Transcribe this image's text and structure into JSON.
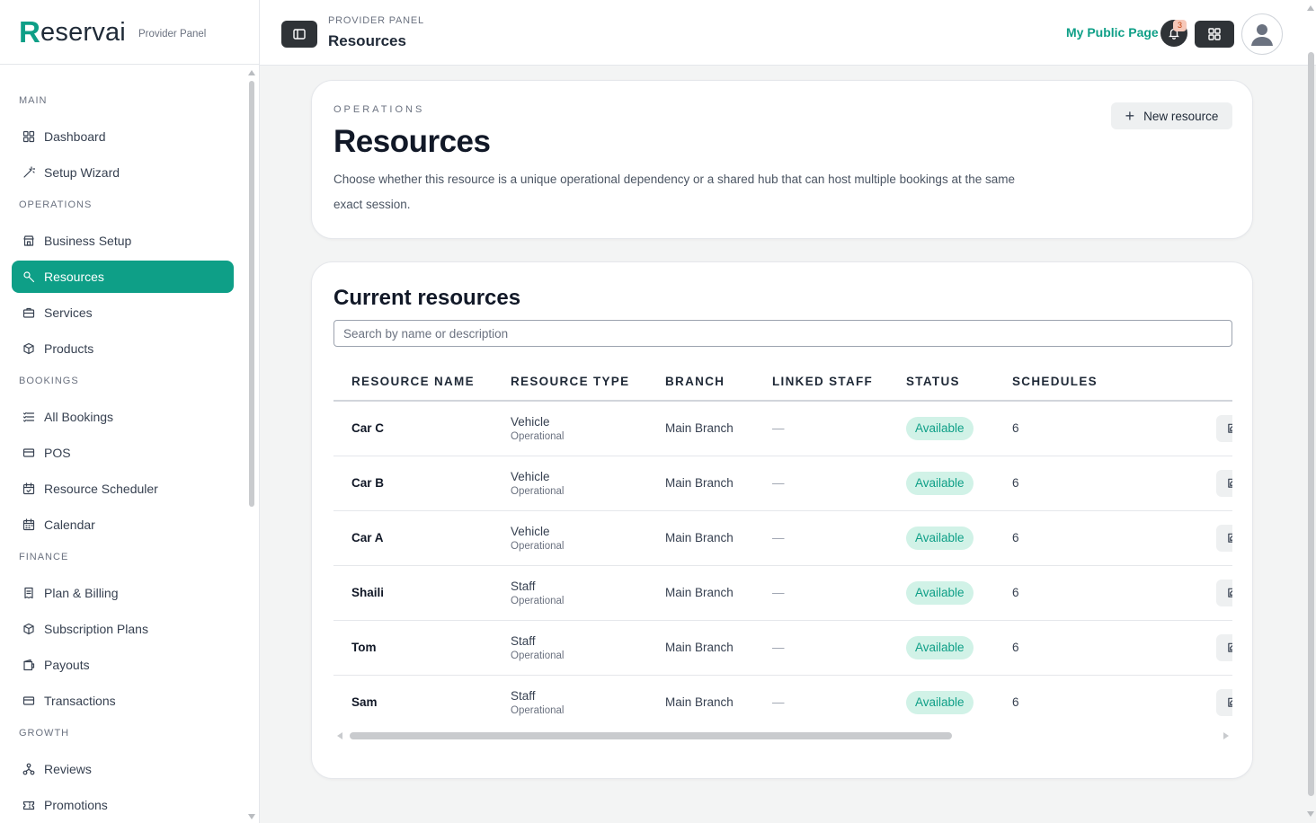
{
  "brand": {
    "logo_initial": "R",
    "logo_rest": "eservai",
    "subtitle": "Provider Panel"
  },
  "sidebar": {
    "sections": [
      {
        "title": "MAIN",
        "items": [
          {
            "label": "Dashboard",
            "icon": "grid-icon"
          },
          {
            "label": "Setup Wizard",
            "icon": "wand-icon"
          }
        ]
      },
      {
        "title": "OPERATIONS",
        "items": [
          {
            "label": "Business Setup",
            "icon": "store-icon"
          },
          {
            "label": "Resources",
            "icon": "wrench-icon",
            "active": true
          },
          {
            "label": "Services",
            "icon": "briefcase-icon"
          },
          {
            "label": "Products",
            "icon": "box-icon"
          }
        ]
      },
      {
        "title": "BOOKINGS",
        "items": [
          {
            "label": "All Bookings",
            "icon": "list-icon"
          },
          {
            "label": "POS",
            "icon": "card-icon"
          },
          {
            "label": "Resource Scheduler",
            "icon": "calendar-check-icon"
          },
          {
            "label": "Calendar",
            "icon": "calendar-icon"
          }
        ]
      },
      {
        "title": "FINANCE",
        "items": [
          {
            "label": "Plan & Billing",
            "icon": "receipt-icon"
          },
          {
            "label": "Subscription Plans",
            "icon": "box-icon"
          },
          {
            "label": "Payouts",
            "icon": "wallet-icon"
          },
          {
            "label": "Transactions",
            "icon": "card-icon"
          }
        ]
      },
      {
        "title": "GROWTH",
        "items": [
          {
            "label": "Reviews",
            "icon": "network-icon"
          },
          {
            "label": "Promotions",
            "icon": "ticket-icon"
          }
        ]
      }
    ]
  },
  "topbar": {
    "crumb_small": "PROVIDER PANEL",
    "crumb_title": "Resources",
    "public_link": "My Public Page",
    "notification_count": "3"
  },
  "hero": {
    "eyebrow": "OPERATIONS",
    "title": "Resources",
    "description": "Choose whether this resource is a unique operational dependency or a shared hub that can host multiple bookings at the same exact session.",
    "new_button": "New resource"
  },
  "resources": {
    "title": "Current resources",
    "search_placeholder": "Search by name or description",
    "columns": [
      "RESOURCE NAME",
      "RESOURCE TYPE",
      "BRANCH",
      "LINKED STAFF",
      "STATUS",
      "SCHEDULES",
      ""
    ],
    "edit_label": "Edit resource",
    "rows": [
      {
        "name": "Car C",
        "type": "Vehicle",
        "subtype": "Operational",
        "branch": "Main Branch",
        "staff": "—",
        "status": "Available",
        "schedules": "6"
      },
      {
        "name": "Car B",
        "type": "Vehicle",
        "subtype": "Operational",
        "branch": "Main Branch",
        "staff": "—",
        "status": "Available",
        "schedules": "6"
      },
      {
        "name": "Car A",
        "type": "Vehicle",
        "subtype": "Operational",
        "branch": "Main Branch",
        "staff": "—",
        "status": "Available",
        "schedules": "6"
      },
      {
        "name": "Shaili",
        "type": "Staff",
        "subtype": "Operational",
        "branch": "Main Branch",
        "staff": "—",
        "status": "Available",
        "schedules": "6"
      },
      {
        "name": "Tom",
        "type": "Staff",
        "subtype": "Operational",
        "branch": "Main Branch",
        "staff": "—",
        "status": "Available",
        "schedules": "6"
      },
      {
        "name": "Sam",
        "type": "Staff",
        "subtype": "Operational",
        "branch": "Main Branch",
        "staff": "—",
        "status": "Available",
        "schedules": "6"
      }
    ]
  },
  "colors": {
    "accent": "#0e9f87",
    "badge_bg": "#d1f2e7",
    "dark_button": "#2f3337"
  }
}
